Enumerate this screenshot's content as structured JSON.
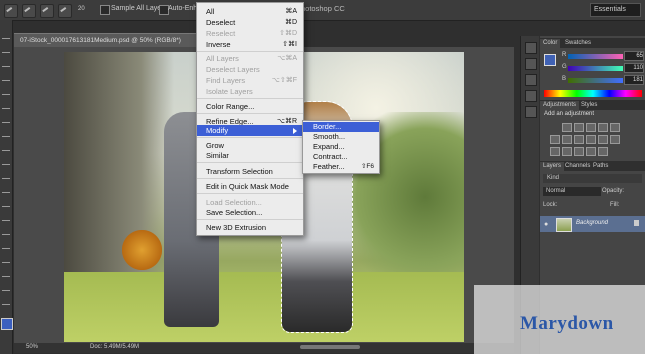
{
  "option_bar": {
    "sample_all_layers": "Sample All Layers",
    "auto_enhance": "Auto-Enhance",
    "app_title": "Photoshop CC",
    "workspace": "Essentials",
    "brush_size": "20"
  },
  "document": {
    "tab_title": "07-iStock_000017613181Medium.psd @ 50% (RGB/8*)",
    "zoom": "50%",
    "doc_size": "Doc: 5.49M/5.49M"
  },
  "select_menu": {
    "items": [
      {
        "label": "All",
        "shortcut": "⌘A"
      },
      {
        "label": "Deselect",
        "shortcut": "⌘D"
      },
      {
        "label": "Reselect",
        "shortcut": "⇧⌘D"
      },
      {
        "label": "Inverse",
        "shortcut": "⇧⌘I"
      },
      {
        "label": "All Layers",
        "shortcut": "⌥⌘A"
      },
      {
        "label": "Deselect Layers",
        "shortcut": ""
      },
      {
        "label": "Find Layers",
        "shortcut": "⌥⇧⌘F"
      },
      {
        "label": "Isolate Layers",
        "shortcut": ""
      },
      {
        "label": "Color Range...",
        "shortcut": ""
      },
      {
        "label": "Refine Edge...",
        "shortcut": "⌥⌘R"
      },
      {
        "label": "Modify",
        "shortcut": ""
      },
      {
        "label": "Grow",
        "shortcut": ""
      },
      {
        "label": "Similar",
        "shortcut": ""
      },
      {
        "label": "Transform Selection",
        "shortcut": ""
      },
      {
        "label": "Edit in Quick Mask Mode",
        "shortcut": ""
      },
      {
        "label": "Load Selection...",
        "shortcut": ""
      },
      {
        "label": "Save Selection...",
        "shortcut": ""
      },
      {
        "label": "New 3D Extrusion",
        "shortcut": ""
      }
    ]
  },
  "modify_submenu": {
    "items": [
      {
        "label": "Border...",
        "shortcut": ""
      },
      {
        "label": "Smooth...",
        "shortcut": ""
      },
      {
        "label": "Expand...",
        "shortcut": ""
      },
      {
        "label": "Contract...",
        "shortcut": ""
      },
      {
        "label": "Feather...",
        "shortcut": "⇧F6"
      }
    ]
  },
  "color_panel": {
    "tabs": [
      "Color",
      "Swatches"
    ],
    "r_label": "R",
    "r_value": "65",
    "g_label": "G",
    "g_value": "110",
    "b_label": "B",
    "b_value": "181",
    "foreground_color": "#4162b5"
  },
  "adjustments_panel": {
    "tabs": [
      "Adjustments",
      "Styles"
    ],
    "add_label": "Add an adjustment"
  },
  "layers_panel": {
    "tabs": [
      "Layers",
      "Channels",
      "Paths"
    ],
    "kind": "Kind",
    "blend_mode": "Normal",
    "opacity_label": "Opacity:",
    "lock_label": "Lock:",
    "fill_label": "Fill:",
    "layer_name": "Background"
  },
  "watermark": "Marydown",
  "colors": {
    "menu_highlight": "#3c5fd6",
    "layer_selected": "#5b6f91"
  }
}
